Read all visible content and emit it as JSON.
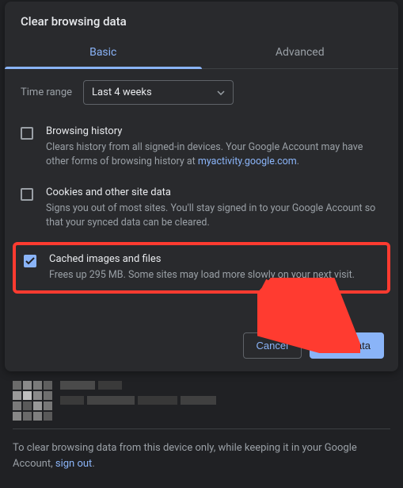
{
  "dialog": {
    "title": "Clear browsing data",
    "tabs": {
      "basic": "Basic",
      "advanced": "Advanced"
    },
    "timeRange": {
      "label": "Time range",
      "value": "Last 4 weeks"
    },
    "options": {
      "history": {
        "title": "Browsing history",
        "desc_pre": "Clears history from all signed-in devices. Your Google Account may have other forms of browsing history at ",
        "link": "myactivity.google.com",
        "desc_post": "."
      },
      "cookies": {
        "title": "Cookies and other site data",
        "desc": "Signs you out of most sites. You'll stay signed in to your Google Account so that your synced data can be cleared."
      },
      "cache": {
        "title": "Cached images and files",
        "desc": "Frees up 295 MB. Some sites may load more slowly on your next visit."
      }
    },
    "buttons": {
      "cancel": "Cancel",
      "clear": "Clear data"
    }
  },
  "footer_note": {
    "text_pre": "To clear browsing data from this device only, while keeping it in your Google Account, ",
    "link": "sign out",
    "text_post": "."
  }
}
